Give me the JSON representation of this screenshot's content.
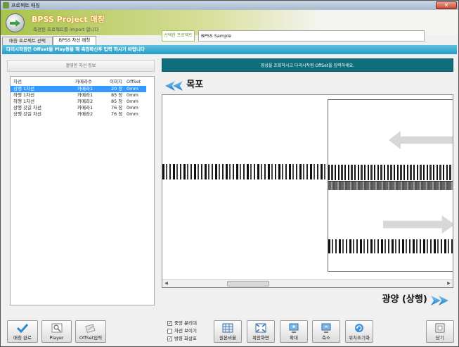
{
  "window": {
    "title": "프로젝트 매칭",
    "close_glyph": "✕"
  },
  "header": {
    "title": "BPSS Project 매칭",
    "subtitle": "측정된 프로젝트를 import 합니다",
    "project_label": "선택한 프로젝트",
    "project_value": "BPSS Sample"
  },
  "tabs": [
    {
      "label": "매칭 프로젝트 선택",
      "active": false
    },
    {
      "label": "BPSS 차선 매칭",
      "active": true
    }
  ],
  "info_bar": "다리시작점인 Offset을 Play등을 해 측점확신후 입력 하시기 바랍니다",
  "left_panel": {
    "header": "촬영한 차선 정보",
    "columns": [
      "차선",
      "카메라수",
      "이미지",
      "OffSet"
    ],
    "rows": [
      {
        "lane": "상행 1차선",
        "camera": "카메라1",
        "images": "20 장",
        "offset": "0mm",
        "selected": true
      },
      {
        "lane": "하행 1차선",
        "camera": "카메라1",
        "images": "85 장",
        "offset": "0mm",
        "selected": false
      },
      {
        "lane": "하행 1차선",
        "camera": "카메라2",
        "images": "85 장",
        "offset": "0mm",
        "selected": false
      },
      {
        "lane": "상행 갓길 차선",
        "camera": "카메라1",
        "images": "76 장",
        "offset": "0mm",
        "selected": false
      },
      {
        "lane": "상행 갓길 차선",
        "camera": "카메라2",
        "images": "76 장",
        "offset": "0mm",
        "selected": false
      }
    ]
  },
  "viewer": {
    "message": "영상을 조회하시고 다리시작점 OffSet을 입력하세요.",
    "direction_top": "목포",
    "direction_bottom": "광양 (상행)",
    "scroll_left": "◀",
    "scroll_right": "▶"
  },
  "buttons": {
    "match_done": "매칭 완료",
    "player": "Player",
    "offset_input": "OffSet입력",
    "original_ratio": "원본비율",
    "full_screen": "꽉찬화면",
    "zoom_in": "확대",
    "zoom_out": "축소",
    "reset_position": "위치초기화",
    "close": "닫기"
  },
  "checkboxes": [
    {
      "label": "중앙 분리대",
      "checked": true
    },
    {
      "label": "차선 보이기",
      "checked": false
    },
    {
      "label": "방향 화살표",
      "checked": true
    }
  ],
  "colors": {
    "info_bar": "#2a9cc7",
    "message_bar": "#0f6e7b",
    "selection": "#3399ff",
    "header_green": "#a8c34a"
  }
}
